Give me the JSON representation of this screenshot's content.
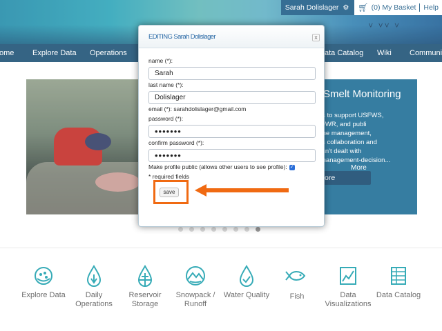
{
  "header": {
    "user_name": "Sarah Dolislager",
    "basket_label": "(0) My Basket",
    "help_label": "Help",
    "colors": {
      "nav": "#1a4f74",
      "accent": "#f06a12"
    }
  },
  "nav": {
    "items": [
      "ome",
      "Explore Data",
      "Operations",
      "ata Catalog",
      "Wiki",
      "Communit"
    ]
  },
  "carousel": {
    "title": "Smelt Monitoring",
    "text_lines": [
      "is to support USFWS,",
      "DWR, and publi",
      "the management,",
      "is collaboration and",
      "isn't dealt with",
      "management-decision..."
    ],
    "more_link": "More",
    "more_button": "ore",
    "slide_count": 8,
    "active_slide": 8
  },
  "quick_links": [
    {
      "label": "Explore Data",
      "icon": "globe-icon"
    },
    {
      "label": "Daily Operations",
      "icon": "water-drop-icon"
    },
    {
      "label": "Reservoir Storage",
      "icon": "reservoir-icon"
    },
    {
      "label": "Snowpack / Runoff",
      "icon": "mountain-icon"
    },
    {
      "label": "Water Quality",
      "icon": "checked-drop-icon"
    },
    {
      "label": "Fish",
      "icon": "fish-icon"
    },
    {
      "label": "Data Visualizations",
      "icon": "chart-icon"
    },
    {
      "label": "Data Catalog",
      "icon": "catalog-icon"
    }
  ],
  "modal": {
    "title": "EDITING Sarah Dolislager",
    "close_label": "x",
    "name_label": "name (*):",
    "name_value": "Sarah",
    "last_name_label": "last name (*):",
    "last_name_value": "Dolislager",
    "email_text": "email (*): sarahdolislager@gmail.com",
    "password_label": "password (*):",
    "password_value": "•••••••",
    "confirm_label": "confirm password (*):",
    "confirm_value": "•••••••",
    "public_label": "Make profile public (allows other users to see profile):",
    "public_checked": true,
    "required_note": "* required fields",
    "save_label": "save"
  }
}
